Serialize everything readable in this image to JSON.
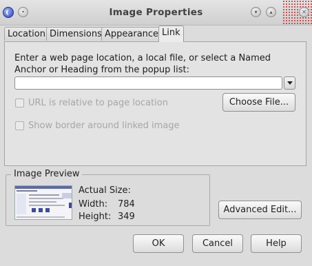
{
  "window": {
    "title": "Image Properties"
  },
  "tabs": [
    {
      "label": "Location"
    },
    {
      "label": "Dimensions"
    },
    {
      "label": "Appearance"
    },
    {
      "label": "Link",
      "active": true
    }
  ],
  "link": {
    "instruction": "Enter a web page location, a local file, or select a Named Anchor or Heading from the popup list:",
    "url_value": "",
    "relative_checkbox_label": "URL is relative to page location",
    "relative_checked": false,
    "choose_file_label": "Choose File...",
    "border_checkbox_label": "Show border around linked image",
    "border_checked": false
  },
  "preview": {
    "legend": "Image Preview",
    "actual_size_label": "Actual Size:",
    "width_label": "Width:",
    "width_value": "784",
    "height_label": "Height:",
    "height_value": "349"
  },
  "buttons": {
    "advanced_edit": "Advanced Edit...",
    "ok": "OK",
    "cancel": "Cancel",
    "help": "Help"
  },
  "colors": {
    "window_bg": "#dcdcdc",
    "panel_bg": "#ececec",
    "disabled_text": "#a6a6a6"
  },
  "icons": [
    "app-icon",
    "menu-icon",
    "minimize-icon",
    "maximize-icon",
    "close-icon",
    "chevron-down-icon"
  ]
}
